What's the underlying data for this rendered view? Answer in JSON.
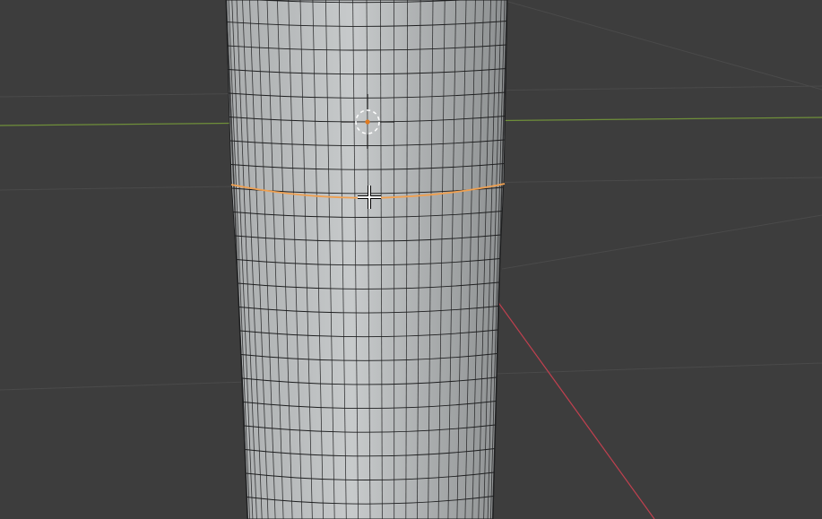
{
  "app": "3D viewport",
  "colors": {
    "background": "#3d3d3d",
    "grid_line": "#4a4a4a",
    "x_axis": "#c0404f",
    "y_axis": "#6f8f3a",
    "mesh_fill_light": "#c7cacb",
    "mesh_fill_mid": "#a9acad",
    "mesh_fill_dark": "#8c8f90",
    "mesh_wire": "#1e1f20",
    "selected_loop": "#f0a050",
    "cursor_red": "#d04a2a",
    "cursor_white": "#ffffff",
    "origin_dot": "#e07a20"
  },
  "icons": {
    "cursor": "3d-cursor-icon",
    "origin": "object-origin-icon",
    "mouse": "crosshair-pointer-icon"
  }
}
